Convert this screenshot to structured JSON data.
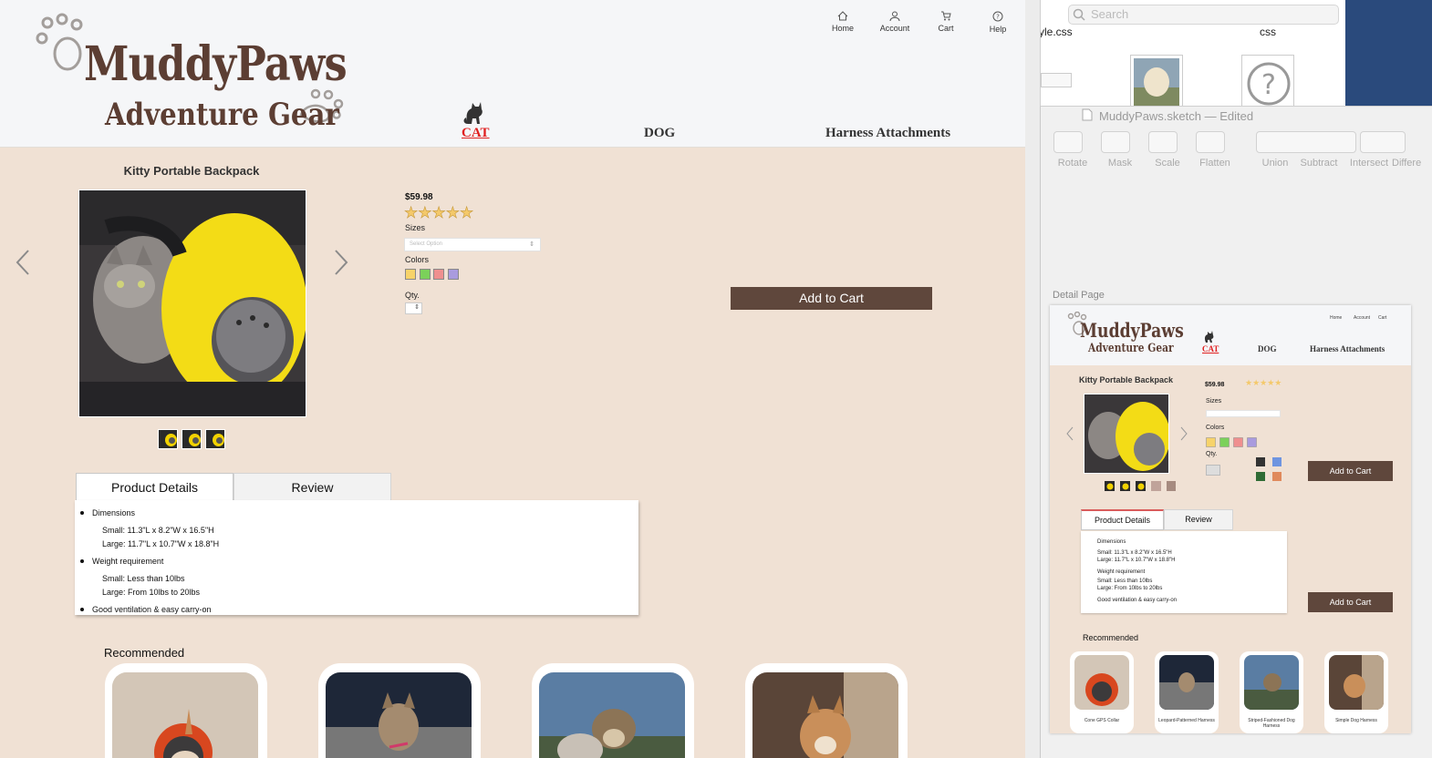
{
  "brand": {
    "name": "MuddyPaws",
    "tagline": "Adventure Gear"
  },
  "topnav": [
    {
      "label": "Home",
      "icon": "home-icon"
    },
    {
      "label": "Account",
      "icon": "account-icon"
    },
    {
      "label": "Cart",
      "icon": "cart-icon"
    },
    {
      "label": "Help",
      "icon": "help-icon"
    }
  ],
  "categories": [
    {
      "label": "CAT",
      "active": true
    },
    {
      "label": "DOG",
      "active": false
    },
    {
      "label": "Harness Attachments",
      "active": false
    }
  ],
  "product": {
    "title": "Kitty Portable Backpack",
    "price": "$59.98",
    "rating": 5,
    "sizes_label": "Sizes",
    "sizes_placeholder": "Select Option",
    "colors_label": "Colors",
    "colors": [
      "#f7d36a",
      "#7bd15a",
      "#ef8f8f",
      "#a99bde"
    ],
    "qty_label": "Qty.",
    "add_to_cart": "Add to Cart"
  },
  "tabs": [
    {
      "label": "Product Details",
      "active": true
    },
    {
      "label": "Review",
      "active": false
    }
  ],
  "details": {
    "dimensions_title": "Dimensions",
    "dimensions_small": "Small: 11.3\"L x 8.2\"W x 16.5\"H",
    "dimensions_large": "Large: 11.7\"L x 10.7\"W x 18.8\"H",
    "weight_title": "Weight requirement",
    "weight_small": "Small: Less than 10lbs",
    "weight_large": "Large: From 10lbs to 20lbs",
    "ventilation": "Good ventilation & easy carry-on"
  },
  "recommended": {
    "title": "Recommended"
  },
  "finder": {
    "search_placeholder": "Search",
    "file_1": "yle.css",
    "file_2": "css"
  },
  "sketch": {
    "window_title": "MuddyPaws.sketch — Edited",
    "toolbar": [
      "Rotate",
      "Mask",
      "Scale",
      "Flatten",
      "Union",
      "Subtract",
      "Intersect",
      "Differe"
    ],
    "artboard_name": "Detail Page",
    "rec_items": [
      "Cone GPS Collar",
      "Leopard-Patterned Harness",
      "Striped-Fashioned Dog Harness",
      "Simple Dog Harness"
    ],
    "add_to_cart": "Add to Cart",
    "add_to_cart_2": "Add to Cart",
    "extra_swatches": [
      "#333333",
      "#6f95e0",
      "#2f6b35",
      "#e08a5c"
    ]
  }
}
